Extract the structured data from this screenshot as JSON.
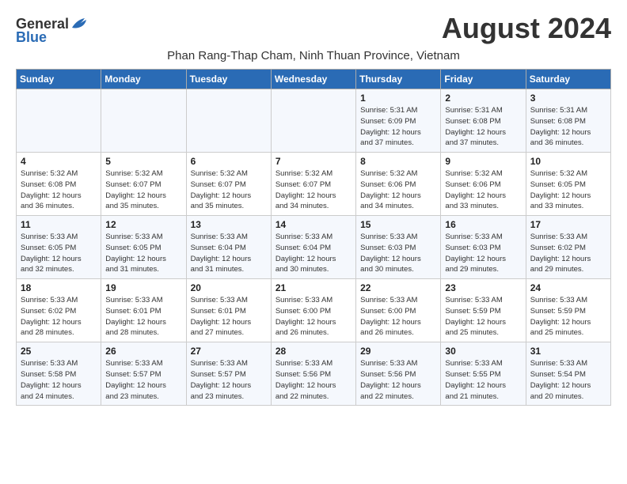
{
  "header": {
    "logo_general": "General",
    "logo_blue": "Blue",
    "month_title": "August 2024",
    "subtitle": "Phan Rang-Thap Cham, Ninh Thuan Province, Vietnam"
  },
  "weekdays": [
    "Sunday",
    "Monday",
    "Tuesday",
    "Wednesday",
    "Thursday",
    "Friday",
    "Saturday"
  ],
  "weeks": [
    [
      {
        "day": "",
        "info": ""
      },
      {
        "day": "",
        "info": ""
      },
      {
        "day": "",
        "info": ""
      },
      {
        "day": "",
        "info": ""
      },
      {
        "day": "1",
        "info": "Sunrise: 5:31 AM\nSunset: 6:09 PM\nDaylight: 12 hours\nand 37 minutes."
      },
      {
        "day": "2",
        "info": "Sunrise: 5:31 AM\nSunset: 6:08 PM\nDaylight: 12 hours\nand 37 minutes."
      },
      {
        "day": "3",
        "info": "Sunrise: 5:31 AM\nSunset: 6:08 PM\nDaylight: 12 hours\nand 36 minutes."
      }
    ],
    [
      {
        "day": "4",
        "info": "Sunrise: 5:32 AM\nSunset: 6:08 PM\nDaylight: 12 hours\nand 36 minutes."
      },
      {
        "day": "5",
        "info": "Sunrise: 5:32 AM\nSunset: 6:07 PM\nDaylight: 12 hours\nand 35 minutes."
      },
      {
        "day": "6",
        "info": "Sunrise: 5:32 AM\nSunset: 6:07 PM\nDaylight: 12 hours\nand 35 minutes."
      },
      {
        "day": "7",
        "info": "Sunrise: 5:32 AM\nSunset: 6:07 PM\nDaylight: 12 hours\nand 34 minutes."
      },
      {
        "day": "8",
        "info": "Sunrise: 5:32 AM\nSunset: 6:06 PM\nDaylight: 12 hours\nand 34 minutes."
      },
      {
        "day": "9",
        "info": "Sunrise: 5:32 AM\nSunset: 6:06 PM\nDaylight: 12 hours\nand 33 minutes."
      },
      {
        "day": "10",
        "info": "Sunrise: 5:32 AM\nSunset: 6:05 PM\nDaylight: 12 hours\nand 33 minutes."
      }
    ],
    [
      {
        "day": "11",
        "info": "Sunrise: 5:33 AM\nSunset: 6:05 PM\nDaylight: 12 hours\nand 32 minutes."
      },
      {
        "day": "12",
        "info": "Sunrise: 5:33 AM\nSunset: 6:05 PM\nDaylight: 12 hours\nand 31 minutes."
      },
      {
        "day": "13",
        "info": "Sunrise: 5:33 AM\nSunset: 6:04 PM\nDaylight: 12 hours\nand 31 minutes."
      },
      {
        "day": "14",
        "info": "Sunrise: 5:33 AM\nSunset: 6:04 PM\nDaylight: 12 hours\nand 30 minutes."
      },
      {
        "day": "15",
        "info": "Sunrise: 5:33 AM\nSunset: 6:03 PM\nDaylight: 12 hours\nand 30 minutes."
      },
      {
        "day": "16",
        "info": "Sunrise: 5:33 AM\nSunset: 6:03 PM\nDaylight: 12 hours\nand 29 minutes."
      },
      {
        "day": "17",
        "info": "Sunrise: 5:33 AM\nSunset: 6:02 PM\nDaylight: 12 hours\nand 29 minutes."
      }
    ],
    [
      {
        "day": "18",
        "info": "Sunrise: 5:33 AM\nSunset: 6:02 PM\nDaylight: 12 hours\nand 28 minutes."
      },
      {
        "day": "19",
        "info": "Sunrise: 5:33 AM\nSunset: 6:01 PM\nDaylight: 12 hours\nand 28 minutes."
      },
      {
        "day": "20",
        "info": "Sunrise: 5:33 AM\nSunset: 6:01 PM\nDaylight: 12 hours\nand 27 minutes."
      },
      {
        "day": "21",
        "info": "Sunrise: 5:33 AM\nSunset: 6:00 PM\nDaylight: 12 hours\nand 26 minutes."
      },
      {
        "day": "22",
        "info": "Sunrise: 5:33 AM\nSunset: 6:00 PM\nDaylight: 12 hours\nand 26 minutes."
      },
      {
        "day": "23",
        "info": "Sunrise: 5:33 AM\nSunset: 5:59 PM\nDaylight: 12 hours\nand 25 minutes."
      },
      {
        "day": "24",
        "info": "Sunrise: 5:33 AM\nSunset: 5:59 PM\nDaylight: 12 hours\nand 25 minutes."
      }
    ],
    [
      {
        "day": "25",
        "info": "Sunrise: 5:33 AM\nSunset: 5:58 PM\nDaylight: 12 hours\nand 24 minutes."
      },
      {
        "day": "26",
        "info": "Sunrise: 5:33 AM\nSunset: 5:57 PM\nDaylight: 12 hours\nand 23 minutes."
      },
      {
        "day": "27",
        "info": "Sunrise: 5:33 AM\nSunset: 5:57 PM\nDaylight: 12 hours\nand 23 minutes."
      },
      {
        "day": "28",
        "info": "Sunrise: 5:33 AM\nSunset: 5:56 PM\nDaylight: 12 hours\nand 22 minutes."
      },
      {
        "day": "29",
        "info": "Sunrise: 5:33 AM\nSunset: 5:56 PM\nDaylight: 12 hours\nand 22 minutes."
      },
      {
        "day": "30",
        "info": "Sunrise: 5:33 AM\nSunset: 5:55 PM\nDaylight: 12 hours\nand 21 minutes."
      },
      {
        "day": "31",
        "info": "Sunrise: 5:33 AM\nSunset: 5:54 PM\nDaylight: 12 hours\nand 20 minutes."
      }
    ]
  ]
}
